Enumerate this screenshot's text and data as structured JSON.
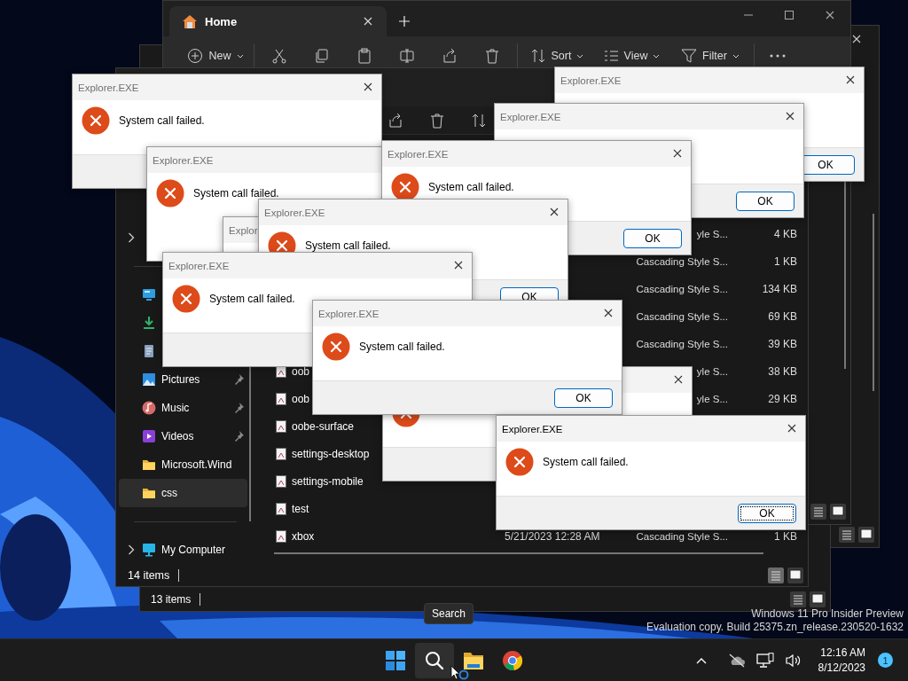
{
  "desktop": {
    "watermark": [
      "Windows 11 Pro Insider Preview",
      "Evaluation copy. Build 25375.zn_release.230520-1632"
    ]
  },
  "background_windows": [
    {
      "kind": "plain"
    },
    {
      "kind": "status",
      "status": "13 items"
    },
    {
      "kind": "tabbed",
      "tab": "Home",
      "toolbar": [
        {
          "kind": "new",
          "label": "New"
        },
        {
          "kind": "cut"
        },
        {
          "kind": "copy"
        },
        {
          "kind": "paste"
        },
        {
          "kind": "rename"
        },
        {
          "kind": "share"
        },
        {
          "kind": "delete"
        },
        {
          "kind": "sort",
          "label": "Sort"
        },
        {
          "kind": "view",
          "label": "View"
        },
        {
          "kind": "filter",
          "label": "Filter"
        },
        {
          "kind": "more"
        }
      ]
    }
  ],
  "explorer": {
    "sidebar": [
      {
        "kind": "blank",
        "expandable": true,
        "pinned": false,
        "selected": false
      },
      {
        "kind": "divider"
      },
      {
        "kind": "desktop",
        "expandable": false,
        "pinned": false,
        "selected": false
      },
      {
        "kind": "downloads",
        "expandable": false,
        "pinned": false,
        "selected": false
      },
      {
        "kind": "documents",
        "expandable": false,
        "pinned": false,
        "selected": false
      },
      {
        "kind": "pictures",
        "label": "Pictures",
        "expandable": false,
        "pinned": true,
        "selected": false
      },
      {
        "kind": "music",
        "label": "Music",
        "expandable": false,
        "pinned": true,
        "selected": false
      },
      {
        "kind": "videos",
        "label": "Videos",
        "expandable": false,
        "pinned": true,
        "selected": false
      },
      {
        "kind": "folder",
        "label": "Microsoft.Wind",
        "expandable": false,
        "pinned": false,
        "selected": false
      },
      {
        "kind": "folder",
        "label": "css",
        "expandable": false,
        "pinned": false,
        "selected": true
      },
      {
        "kind": "divider"
      },
      {
        "kind": "computer",
        "label": "My Computer",
        "expandable": true,
        "pinned": false,
        "selected": false
      }
    ],
    "files": [
      {
        "type": "yle S...",
        "size": "4 KB"
      },
      {
        "type": "Cascading Style S...",
        "size": "1 KB"
      },
      {
        "type": "Cascading Style S...",
        "size": "134 KB"
      },
      {
        "type": "Cascading Style S...",
        "size": "69 KB"
      },
      {
        "type": "Cascading Style S...",
        "size": "39 KB"
      },
      {
        "name": "oob",
        "type": "yle S...",
        "size": "38 KB"
      },
      {
        "name": "oob",
        "type": "yle S...",
        "size": "29 KB"
      },
      {
        "name": "oobe-surface"
      },
      {
        "name": "settings-desktop"
      },
      {
        "name": "settings-mobile"
      },
      {
        "name": "test"
      },
      {
        "name": "xbox",
        "date": "5/21/2023 12:28 AM",
        "type": "Cascading Style S...",
        "size": "1 KB"
      }
    ],
    "status": "14 items"
  },
  "dialogs": [
    {
      "kind": "error",
      "title": "Explorer.EXE",
      "message": "System call failed.",
      "close_button": true,
      "button_bar": true,
      "active": false
    },
    {
      "kind": "error",
      "title": "Explorer.EXE",
      "message": "System call failed.",
      "active": false
    },
    {
      "title": "Explorer.EXE",
      "button": "OK",
      "close_button": true,
      "button_bar": true,
      "active": false
    },
    {
      "title": "Explorer.EXE",
      "button": "OK",
      "close_button": true,
      "button_bar": true,
      "active": false
    },
    {
      "kind": "error",
      "title": "Explorer.EXE",
      "message": "System call failed.",
      "button": "OK",
      "close_button": true,
      "button_bar": true,
      "active": false
    },
    {
      "title": "Explor",
      "active": false
    },
    {
      "kind": "error",
      "title": "Explorer.EXE",
      "message": "System call failed.",
      "button": "OK",
      "close_button": true,
      "button_bar": true,
      "active": false
    },
    {
      "kind": "error",
      "title": "Explorer.EXE",
      "message": "System call failed.",
      "close_button": true,
      "button_bar": true,
      "active": false
    },
    {
      "kind": "error",
      "close_button": true,
      "button_bar": true
    },
    {
      "kind": "error",
      "title": "Explorer.EXE",
      "message": "System call failed.",
      "button": "OK",
      "close_button": true,
      "button_bar": true,
      "active": false
    },
    {
      "kind": "error",
      "title": "Explorer.EXE",
      "message": "System call failed.",
      "button": "OK",
      "close_button": true,
      "button_bar": true,
      "active": true
    }
  ],
  "taskbar": {
    "apps": [
      {
        "kind": "start",
        "selected": false
      },
      {
        "kind": "search",
        "selected": true
      },
      {
        "kind": "files",
        "selected": false
      },
      {
        "kind": "browser",
        "selected": false
      }
    ],
    "tooltip": "Search",
    "time": "12:16 AM",
    "date": "8/12/2023",
    "notification_count": "1"
  }
}
